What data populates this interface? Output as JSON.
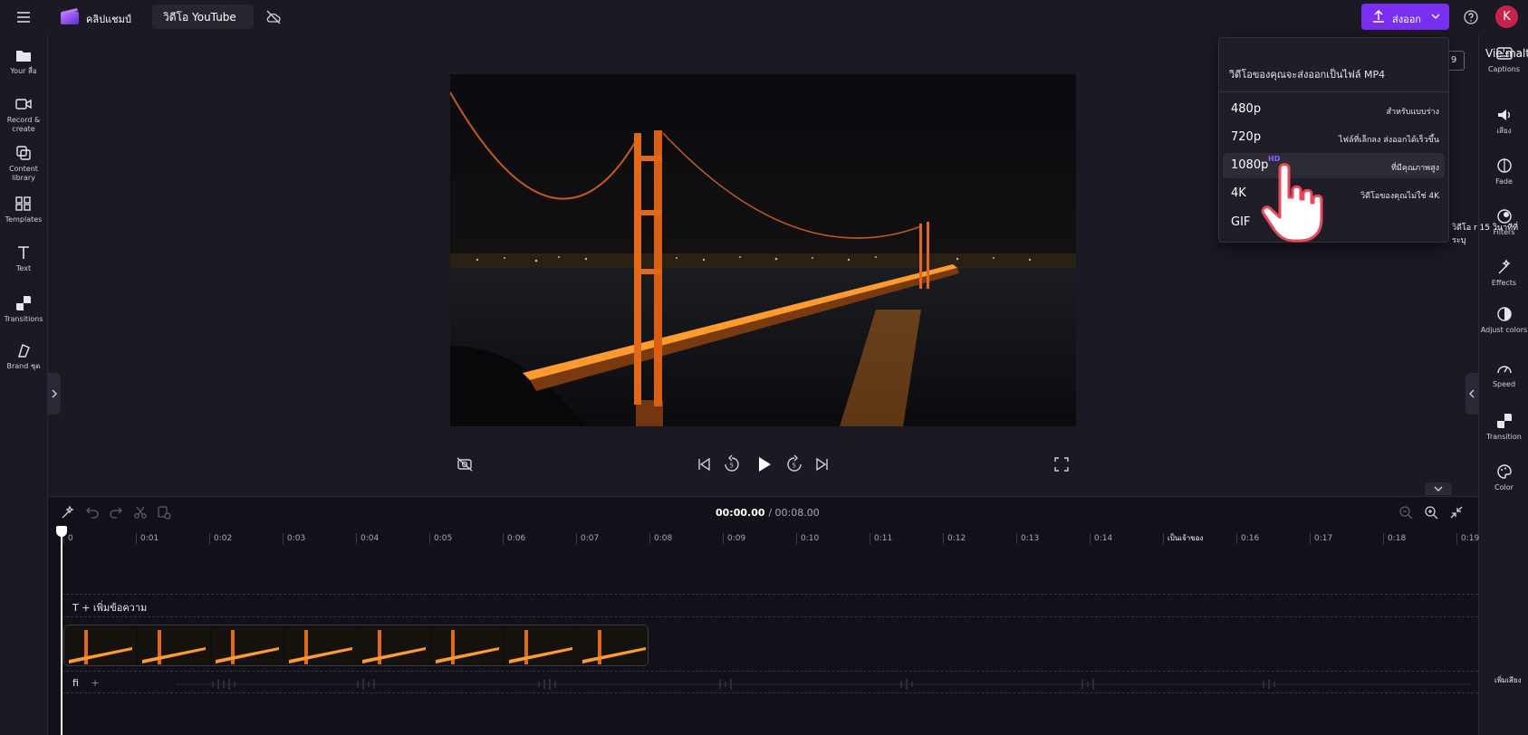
{
  "topbar": {
    "app_name": "คลิปแชมป์",
    "project_title": "วิดีโอ YouTube",
    "export_label": "ส่งออก",
    "avatar_initial": "K"
  },
  "left_sidebar": {
    "items": [
      {
        "label": "Your สื่อ",
        "icon": "folder-icon"
      },
      {
        "label": "Record & create",
        "icon": "camera-icon"
      },
      {
        "label": "Content library",
        "icon": "library-icon"
      },
      {
        "label": "Templates",
        "icon": "templates-icon"
      },
      {
        "label": "Text",
        "icon": "text-icon"
      },
      {
        "label": "Transitions",
        "icon": "transitions-icon"
      },
      {
        "label": "Brand ชุด",
        "icon": "brand-kit-icon"
      }
    ]
  },
  "right_sidebar": {
    "items": [
      {
        "label": "Captions",
        "icon": "captions-icon"
      },
      {
        "label": "เสียง",
        "icon": "audio-icon"
      },
      {
        "label": "Fade",
        "icon": "fade-icon"
      },
      {
        "label": "Filters",
        "icon": "filters-icon"
      },
      {
        "label": "Effects",
        "icon": "effects-icon"
      },
      {
        "label": "Adjust colors",
        "icon": "adjust-colors-icon"
      },
      {
        "label": "Speed",
        "icon": "speed-icon"
      },
      {
        "label": "Transition",
        "icon": "transition-icon"
      },
      {
        "label": "Color",
        "icon": "color-icon"
      }
    ],
    "overflow_texts": {
      "top": "Vie'malty",
      "filters_tip": "วิดีโอ r 15 วินาทีที่ระบุ",
      "add_audio": "เพิ่มเสียง"
    }
  },
  "preview": {
    "aspect_ratio_label": "9"
  },
  "export_menu": {
    "header": "วิดีโอของคุณจะส่งออกเป็นไฟล์ MP4",
    "options": [
      {
        "res": "480p",
        "desc": "สำหรับแบบร่าง",
        "badge": ""
      },
      {
        "res": "720p",
        "desc": "ไฟล์ที่เล็กลง ส่งออกได้เร็วขึ้น",
        "badge": ""
      },
      {
        "res": "1080p",
        "desc": "ที่มีคุณภาพสูง",
        "badge": "HD"
      },
      {
        "res": "4K",
        "desc": "วิดีโอของคุณไม่ใช่ 4K",
        "badge": ""
      },
      {
        "res": "GIF",
        "desc": "",
        "badge": ""
      }
    ],
    "active_index": 2
  },
  "timeline": {
    "current_time": "00:00.00",
    "duration": "/ 00:08.00",
    "ticks": [
      "0",
      "0:01",
      "0:02",
      "0:03",
      "0:04",
      "0:05",
      "0:06",
      "0:07",
      "0:08",
      "0:09",
      "0:10",
      "0:11",
      "0:12",
      "0:13",
      "0:14",
      "เป็นเจ้าของ",
      "0:16",
      "0:17",
      "0:18",
      "0:19"
    ],
    "text_track_label": "T + เพิ่มข้อความ",
    "audio_track_label": "fi",
    "audio_add": "+"
  },
  "colors": {
    "accent": "#7a2ff0",
    "avatar": "#c8224a",
    "background": "#1b1a24",
    "timeline_bg": "#121119"
  }
}
